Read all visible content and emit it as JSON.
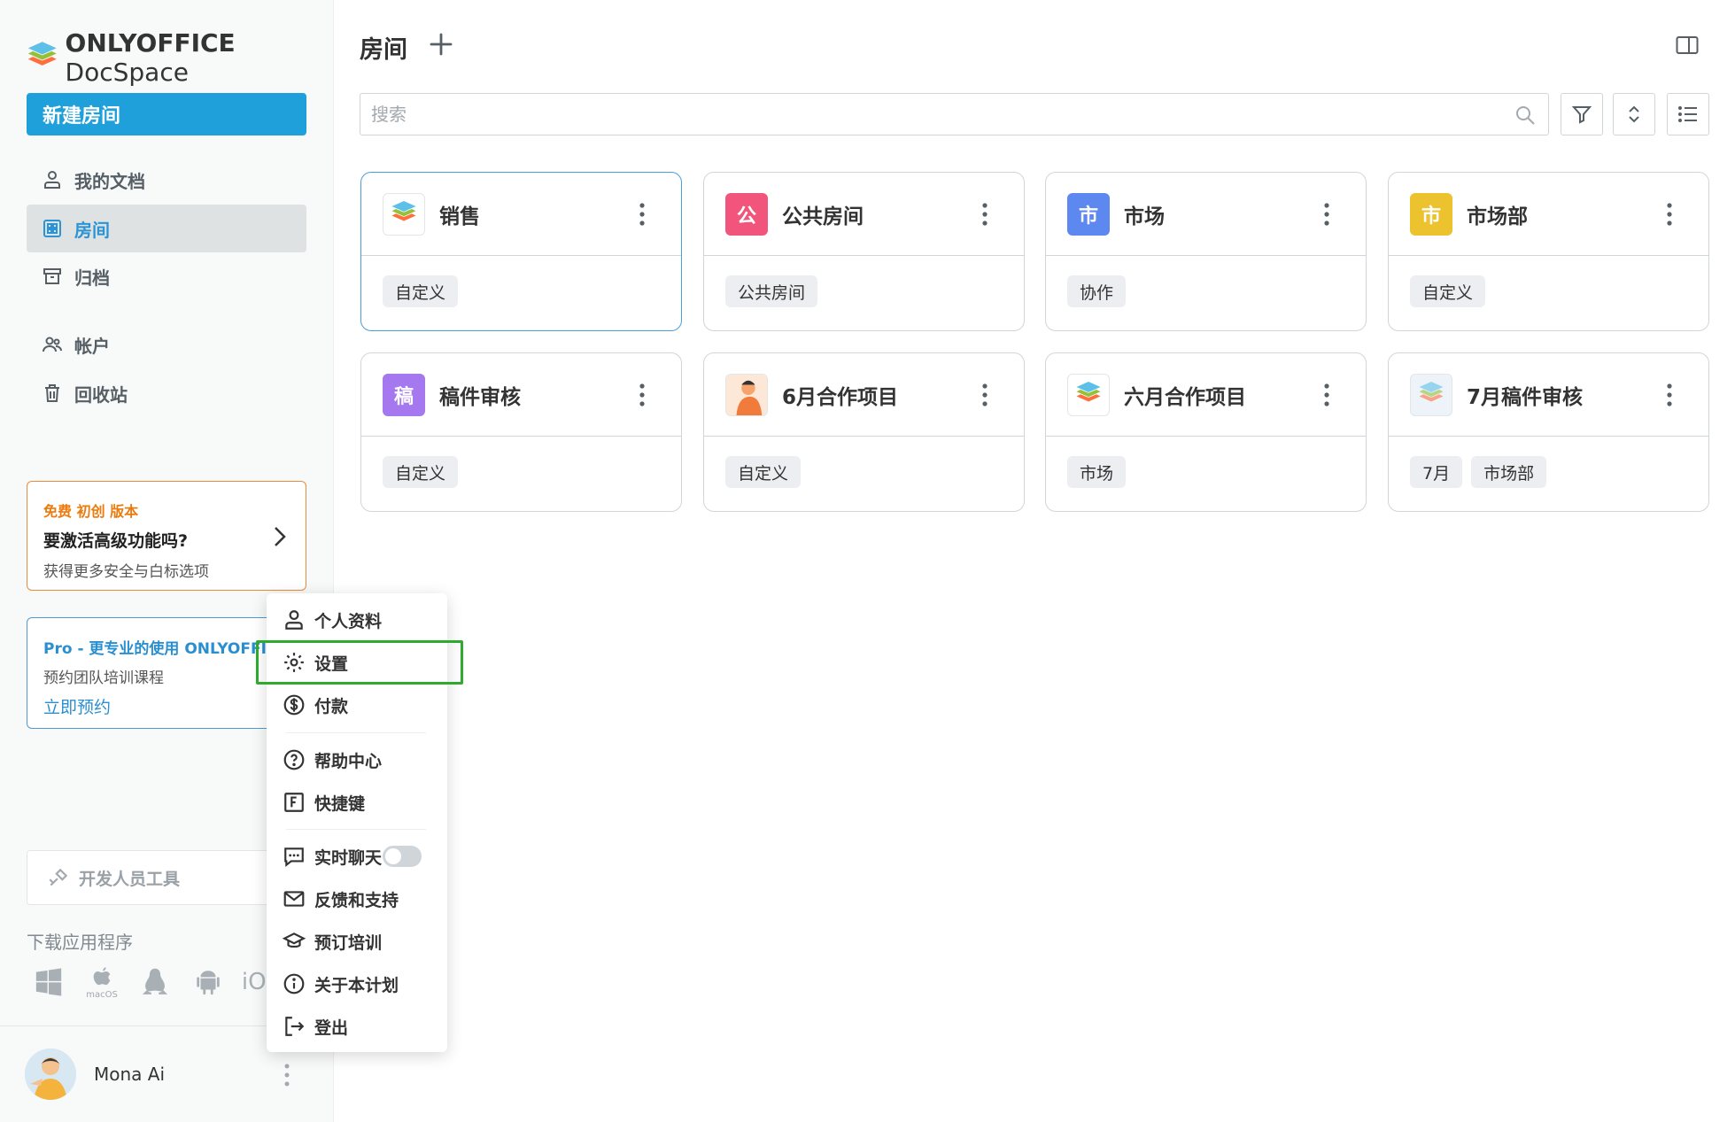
{
  "app": {
    "logo_text_bold": "ONLYOFFICE",
    "logo_text_regular": " DocSpace"
  },
  "sidebar": {
    "new_room_label": "新建房间",
    "nav": [
      {
        "label": "我的文档",
        "icon": "person-icon"
      },
      {
        "label": "房间",
        "icon": "rooms-grid-icon",
        "active": true
      },
      {
        "label": "归档",
        "icon": "archive-icon"
      },
      {
        "label": "帐户",
        "icon": "accounts-icon"
      },
      {
        "label": "回收站",
        "icon": "trash-icon"
      }
    ],
    "promo": {
      "tag": "免费 初创 版本",
      "title": "要激活高级功能吗?",
      "subtitle": "获得更多安全与白标选项"
    },
    "pro": {
      "title": "Pro - 更专业的使用 ONLYOFFICE",
      "subtitle": "预约团队培训课程",
      "link": "立即预约"
    },
    "dev_tools_label": "开发人员工具",
    "download_label": "下载应用程序",
    "apps": [
      {
        "name": "windows-icon"
      },
      {
        "name": "macos-icon",
        "caption": "macOS"
      },
      {
        "name": "linux-icon"
      },
      {
        "name": "android-icon"
      },
      {
        "name": "ios-icon",
        "caption": "iOS"
      }
    ],
    "user": {
      "name": "Mona Ai"
    }
  },
  "header": {
    "title": "房间"
  },
  "search": {
    "placeholder": "搜索",
    "value": ""
  },
  "rooms": [
    {
      "name": "销售",
      "logo": "onlyoffice-logo",
      "tags": [
        "自定义"
      ]
    },
    {
      "name": "公共房间",
      "logo_text": "公",
      "color": "#f2557c",
      "tags": [
        "公共房间"
      ]
    },
    {
      "name": "市场",
      "logo_text": "市",
      "color": "#5c88f0",
      "tags": [
        "协作"
      ]
    },
    {
      "name": "市场部",
      "logo_text": "市",
      "color": "#ecc32e",
      "tags": [
        "自定义"
      ]
    },
    {
      "name": "稿件审核",
      "logo_text": "稿",
      "color": "#a678f0",
      "tags": [
        "自定义"
      ]
    },
    {
      "name": "6月合作项目",
      "logo": "illustration-logo",
      "tags": [
        "自定义"
      ]
    },
    {
      "name": "六月合作项目",
      "logo": "onlyoffice-logo",
      "tags": [
        "市场"
      ]
    },
    {
      "name": "7月稿件审核",
      "logo": "onlyoffice-logo-faded",
      "tags": [
        "7月",
        "市场部"
      ]
    }
  ],
  "menu": {
    "items": [
      {
        "label": "个人资料",
        "icon": "profile-icon"
      },
      {
        "label": "设置",
        "icon": "gear-icon"
      },
      {
        "label": "付款",
        "icon": "dollar-icon"
      },
      {
        "label": "帮助中心",
        "icon": "help-icon"
      },
      {
        "label": "快捷键",
        "icon": "hotkeys-icon"
      },
      {
        "label": "实时聊天",
        "icon": "chat-icon",
        "toggle": false
      },
      {
        "label": "反馈和支持",
        "icon": "mail-icon"
      },
      {
        "label": "预订培训",
        "icon": "graduation-icon"
      },
      {
        "label": "关于本计划",
        "icon": "info-icon"
      },
      {
        "label": "登出",
        "icon": "logout-icon"
      }
    ]
  },
  "colors": {
    "accent": "#1fa0da",
    "promo_border": "#e88b3a",
    "highlight": "#2eaa2e"
  }
}
